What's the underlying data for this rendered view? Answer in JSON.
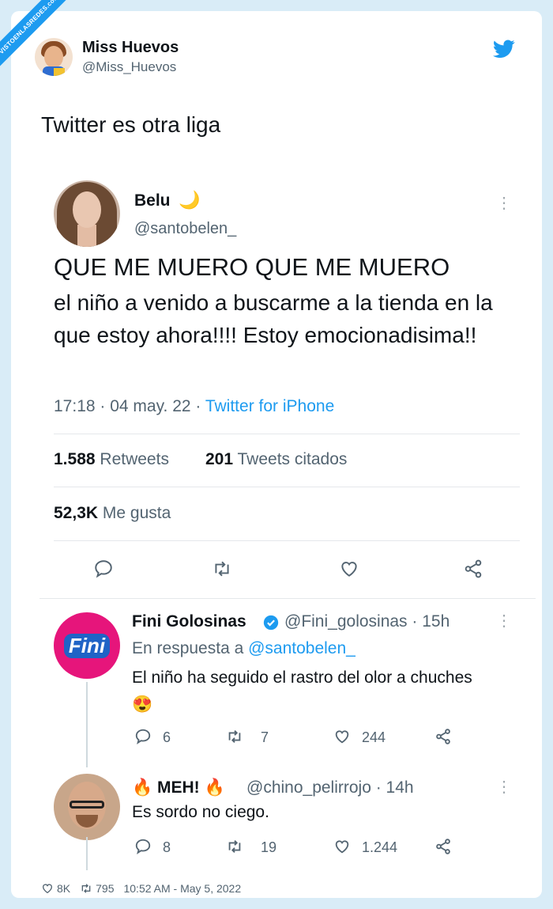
{
  "watermark": "VISTOENLASREDES.com",
  "outer": {
    "name": "Miss Huevos",
    "handle": "@Miss_Huevos",
    "text": "Twitter es otra liga",
    "icon": "twitter-bird-icon",
    "footer": {
      "likes": "8K",
      "retweets": "795",
      "timestamp": "10:52 AM - May 5, 2022"
    }
  },
  "tweet": {
    "name": "Belu",
    "name_emoji": "🌙",
    "handle": "@santobelen_",
    "line1": "QUE ME MUERO QUE ME MUERO",
    "line2": "el niño a venido a buscarme a la tienda en la que estoy ahora!!!! Estoy emocionadisima!!",
    "time": "17:18 · 04 may. 22 · ",
    "source": "Twitter for iPhone",
    "retweets_count": "1.588",
    "retweets_label": "Retweets",
    "quotes_count": "201",
    "quotes_label": "Tweets citados",
    "likes_count": "52,3K",
    "likes_label": "Me gusta",
    "more": "⋮"
  },
  "replies": [
    {
      "name": "Fini Golosinas",
      "verified": true,
      "handle": "@Fini_golosinas · 15h",
      "reply_to_label": "En respuesta a ",
      "reply_to_handle": "@santobelen_",
      "text": "El niño ha seguido el rastro del olor a chuches 😍",
      "replies": "6",
      "retweets": "7",
      "likes": "244",
      "avatar_text": "Fini",
      "more": "⋮"
    },
    {
      "name": "🔥 MEH! 🔥",
      "handle": "@chino_pelirrojo · 14h",
      "text": "Es sordo no ciego.",
      "replies": "8",
      "retweets": "19",
      "likes": "1.244",
      "more": "⋮"
    }
  ],
  "colors": {
    "accent": "#1d9bf0",
    "muted": "#536471",
    "background": "#d9ecf7"
  }
}
